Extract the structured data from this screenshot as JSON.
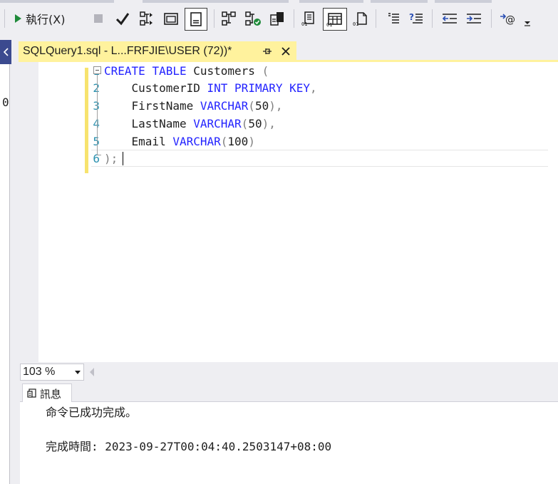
{
  "toolbar": {
    "execute_label": "執行(X)",
    "icons": [
      "execute-icon",
      "stop-icon",
      "parse-icon",
      "estimated-plan-icon",
      "query-options-icon",
      "results-to-grid-icon",
      "include-actual-plan-icon",
      "live-stats-icon",
      "client-stats-icon",
      "results-to-text-icon",
      "results-to-grid-toggle-icon",
      "results-to-file-icon",
      "comment-icon",
      "uncomment-icon",
      "decrease-indent-icon",
      "increase-indent-icon",
      "specify-values-icon",
      "overflow-icon"
    ]
  },
  "left_dock": {
    "visible_digit": "0"
  },
  "document_tab": {
    "title": "SQLQuery1.sql - L...FRFJIE\\USER (72))*",
    "pin_glyph": "⊣",
    "close_glyph": "✕"
  },
  "editor": {
    "line_numbers": [
      "1",
      "2",
      "3",
      "4",
      "5",
      "6"
    ],
    "lines": [
      {
        "indent": "",
        "tokens": [
          {
            "t": "CREATE",
            "k": "kw"
          },
          {
            "t": " ",
            "k": "ident"
          },
          {
            "t": "TABLE",
            "k": "kw"
          },
          {
            "t": " Customers ",
            "k": "ident"
          },
          {
            "t": "(",
            "k": "punct"
          }
        ]
      },
      {
        "indent": "    ",
        "tokens": [
          {
            "t": "CustomerID ",
            "k": "ident"
          },
          {
            "t": "INT",
            "k": "kw"
          },
          {
            "t": " ",
            "k": "ident"
          },
          {
            "t": "PRIMARY",
            "k": "kw"
          },
          {
            "t": " ",
            "k": "ident"
          },
          {
            "t": "KEY",
            "k": "kw"
          },
          {
            "t": ",",
            "k": "punct"
          }
        ]
      },
      {
        "indent": "    ",
        "tokens": [
          {
            "t": "FirstName ",
            "k": "ident"
          },
          {
            "t": "VARCHAR",
            "k": "kw"
          },
          {
            "t": "(",
            "k": "punct"
          },
          {
            "t": "50",
            "k": "ident"
          },
          {
            "t": "),",
            "k": "punct"
          }
        ]
      },
      {
        "indent": "    ",
        "tokens": [
          {
            "t": "LastName ",
            "k": "ident"
          },
          {
            "t": "VARCHAR",
            "k": "kw"
          },
          {
            "t": "(",
            "k": "punct"
          },
          {
            "t": "50",
            "k": "ident"
          },
          {
            "t": "),",
            "k": "punct"
          }
        ]
      },
      {
        "indent": "    ",
        "tokens": [
          {
            "t": "Email ",
            "k": "ident"
          },
          {
            "t": "VARCHAR",
            "k": "kw"
          },
          {
            "t": "(",
            "k": "punct"
          },
          {
            "t": "100",
            "k": "ident"
          },
          {
            "t": ")",
            "k": "punct"
          }
        ]
      },
      {
        "indent": "",
        "tokens": [
          {
            "t": ");",
            "k": "punct"
          }
        ]
      }
    ]
  },
  "zoom": {
    "value": "103 %"
  },
  "results": {
    "tab_label": "訊息",
    "line1": "命令已成功完成。",
    "line2": "完成時間: 2023-09-27T00:04:40.2503147+08:00"
  },
  "colors": {
    "tab_yellow": "#fff29d",
    "keyword_blue": "#2323ff",
    "line_number": "#2b91af",
    "dock_blue": "#3b4a8f"
  }
}
